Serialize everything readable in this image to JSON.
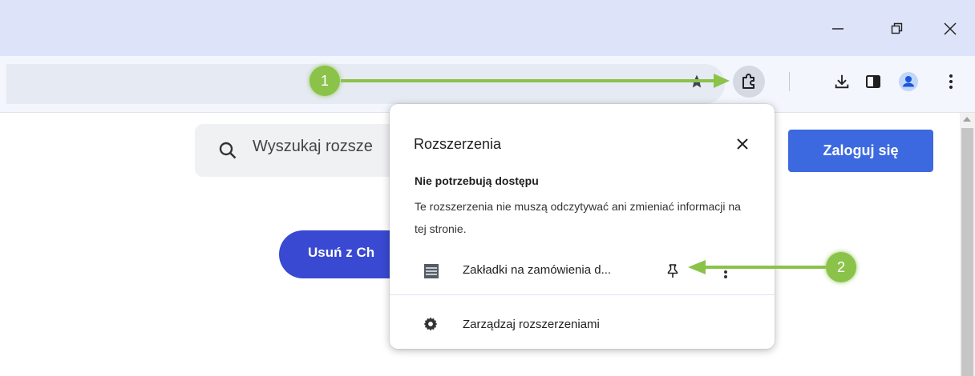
{
  "browser": {
    "window_controls": [
      "minimize-icon",
      "restore-icon",
      "close-icon"
    ],
    "toolbar_icons": [
      "star-icon",
      "puzzle-icon",
      "download-icon",
      "side-panel-icon",
      "profile-icon",
      "more-vert-icon"
    ]
  },
  "page": {
    "search_placeholder": "Wyszukaj rozsze",
    "remove_button": "Usuń z Ch",
    "login_button": "Zaloguj się"
  },
  "extensions_popup": {
    "title": "Rozszerzenia",
    "section_heading": "Nie potrzebują dostępu",
    "section_description": "Te rozszerzenia nie muszą odczytywać ani zmieniać informacji na tej stronie.",
    "extension_name": "Zakładki na zamówienia d...",
    "manage_label": "Zarządzaj rozszerzeniami"
  },
  "annotations": {
    "badge_1": "1",
    "badge_2": "2",
    "color": "#8bc34a"
  },
  "colors": {
    "titlebar": "#dde3f8",
    "toolbar": "#f3f6fd",
    "primary_button": "#3d69e0",
    "remove_button": "#3949d1"
  }
}
